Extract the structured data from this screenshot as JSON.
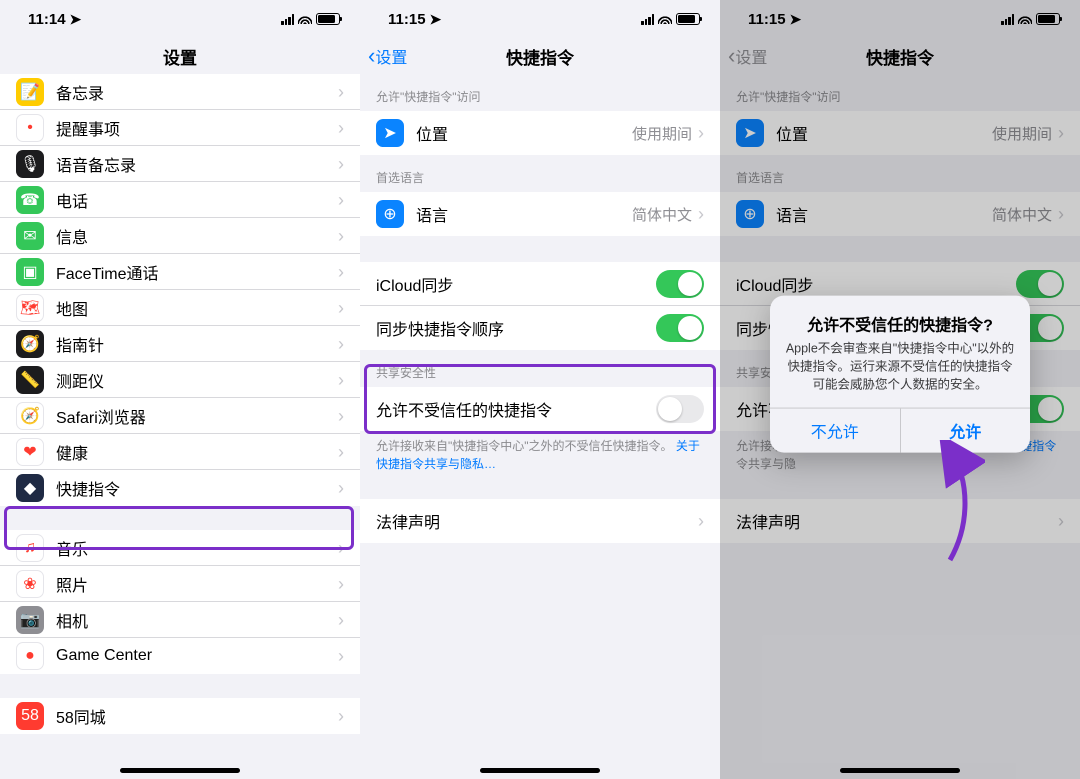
{
  "status": {
    "time1": "11:14",
    "time2": "11:15",
    "time3": "11:15"
  },
  "s1": {
    "header": "设置",
    "rows": [
      {
        "label": "备忘录",
        "bg": "#ffcc00",
        "glyph": "📝"
      },
      {
        "label": "提醒事项",
        "bg": "#ffffff",
        "glyph": "•"
      },
      {
        "label": "语音备忘录",
        "bg": "#1c1c1e",
        "glyph": "🎙"
      },
      {
        "label": "电话",
        "bg": "#34c759",
        "glyph": "☎"
      },
      {
        "label": "信息",
        "bg": "#34c759",
        "glyph": "✉"
      },
      {
        "label": "FaceTime通话",
        "bg": "#34c759",
        "glyph": "▣"
      },
      {
        "label": "地图",
        "bg": "#ffffff",
        "glyph": "🗺"
      },
      {
        "label": "指南针",
        "bg": "#1c1c1e",
        "glyph": "🧭"
      },
      {
        "label": "测距仪",
        "bg": "#1c1c1e",
        "glyph": "📏"
      },
      {
        "label": "Safari浏览器",
        "bg": "#ffffff",
        "glyph": "🧭"
      },
      {
        "label": "健康",
        "bg": "#ffffff",
        "glyph": "❤"
      },
      {
        "label": "快捷指令",
        "bg": "#1f2a44",
        "glyph": "◆"
      }
    ],
    "rows2": [
      {
        "label": "音乐",
        "bg": "#ffffff",
        "glyph": "♫"
      },
      {
        "label": "照片",
        "bg": "#ffffff",
        "glyph": "❀"
      },
      {
        "label": "相机",
        "bg": "#8e8e93",
        "glyph": "📷"
      },
      {
        "label": "Game Center",
        "bg": "#ffffff",
        "glyph": "●"
      }
    ],
    "rows3": [
      {
        "label": "58同城",
        "bg": "#ff3b30",
        "glyph": "58"
      }
    ]
  },
  "s2": {
    "back": "设置",
    "title": "快捷指令",
    "sec_access": "允许\"快捷指令\"访问",
    "loc_label": "位置",
    "loc_detail": "使用期间",
    "sec_lang": "首选语言",
    "lang_label": "语言",
    "lang_detail": "简体中文",
    "icloud": "iCloud同步",
    "order": "同步快捷指令顺序",
    "sec_share": "共享安全性",
    "untrusted": "允许不受信任的快捷指令",
    "note_a": "允许接收来自\"快捷指令中心\"之外的不受信任快捷指令。",
    "note_b": "关于快捷指令共享与隐私…",
    "legal": "法律声明"
  },
  "s3": {
    "back": "设置",
    "title": "快捷指令",
    "alert_title": "允许不受信任的快捷指令?",
    "alert_msg": "Apple不会审查来自\"快捷指令中心\"以外的快捷指令。运行来源不受信任的快捷指令可能会威胁您个人数据的安全。",
    "btn_deny": "不允许",
    "btn_allow": "允许",
    "untrusted_short": "允许不受",
    "note_a_short": "允许接收来",
    "note_b_short": "于快捷指令",
    "note_b_mid": "令共享与隐",
    "sec_share_short": "共享安全",
    "order_short": "同步快捷指令顺序"
  }
}
